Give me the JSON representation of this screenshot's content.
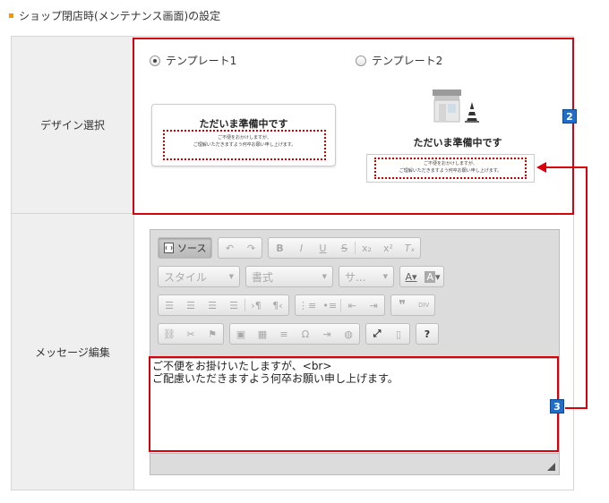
{
  "page": {
    "section_title": "ショップ閉店時(メンテナンス画面)の設定",
    "accent_color": "#f39800"
  },
  "design": {
    "label": "デザイン選択",
    "template1": {
      "label": "テンプレート1",
      "selected": true
    },
    "template2": {
      "label": "テンプレート2",
      "selected": false
    },
    "preview_title": "ただいま準備中です",
    "preview_line1": "ご不便をおかけしますが、",
    "preview_line2": "ご理解いただきますよう何卒お願い申し上げます。"
  },
  "message": {
    "label": "メッセージ編集",
    "content_line1": "ご不便をお掛けいたしますが、<br>",
    "content_line2": "ご配慮いただきますよう何卒お願い申し上げます。"
  },
  "toolbar": {
    "source_label": "ソース",
    "style_label": "スタイル",
    "format_label": "書式",
    "size_label": "サ...",
    "help_label": "?"
  },
  "annotations": {
    "badge2": "2",
    "badge3": "3",
    "highlight_color": "#d9000d",
    "badge_color": "#1f6fc8"
  }
}
